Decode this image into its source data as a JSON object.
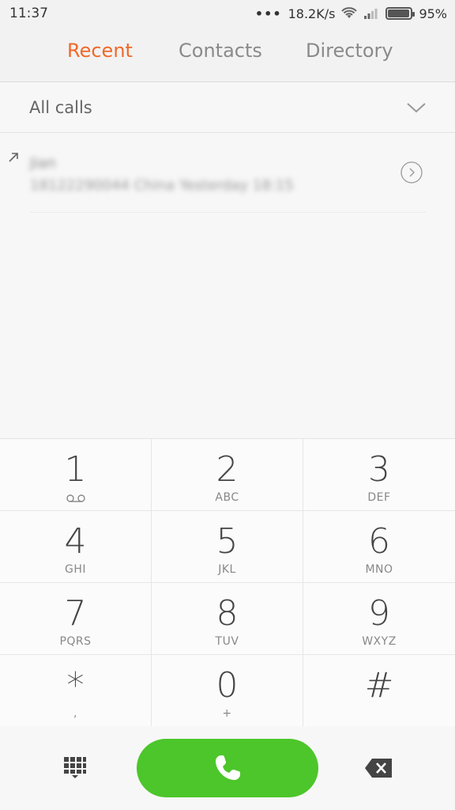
{
  "status_bar": {
    "time": "11:37",
    "dots": "•••",
    "network_speed": "18.2K/s",
    "battery": "95%",
    "battery_level": 0.95
  },
  "tabs": [
    {
      "label": "Recent",
      "active": true
    },
    {
      "label": "Contacts",
      "active": false
    },
    {
      "label": "Directory",
      "active": false
    }
  ],
  "filter": {
    "label": "All calls"
  },
  "call_log": [
    {
      "name": "Jian",
      "detail": "18122290044 China Yesterday 18:15"
    }
  ],
  "keypad": [
    {
      "digit": "1",
      "sub": ""
    },
    {
      "digit": "2",
      "sub": "ABC"
    },
    {
      "digit": "3",
      "sub": "DEF"
    },
    {
      "digit": "4",
      "sub": "GHI"
    },
    {
      "digit": "5",
      "sub": "JKL"
    },
    {
      "digit": "6",
      "sub": "MNO"
    },
    {
      "digit": "7",
      "sub": "PQRS"
    },
    {
      "digit": "8",
      "sub": "TUV"
    },
    {
      "digit": "9",
      "sub": "WXYZ"
    },
    {
      "digit": "*",
      "sub": ","
    },
    {
      "digit": "0",
      "sub": "+"
    },
    {
      "digit": "#",
      "sub": ""
    }
  ],
  "colors": {
    "accent": "#f0692a",
    "call_button": "#4cc62a"
  }
}
